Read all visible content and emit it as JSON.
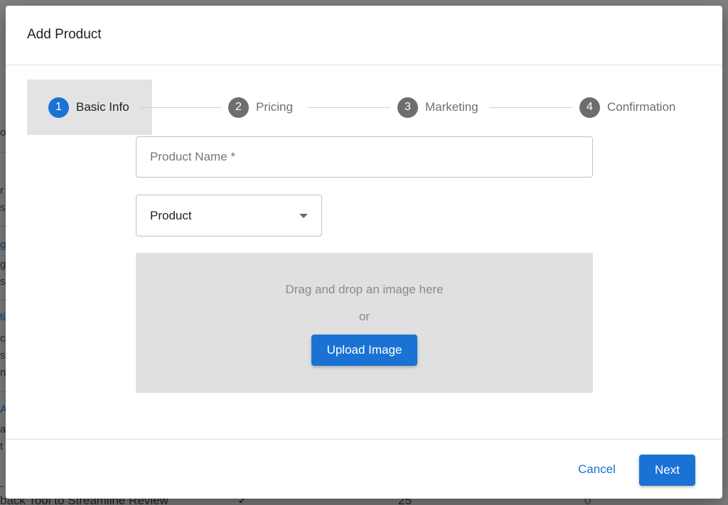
{
  "background": {
    "fragments": [
      {
        "text": "o",
        "link": false
      },
      {
        "text": "r",
        "link": false
      },
      {
        "text": "s",
        "link": false
      },
      {
        "text": "g",
        "link": true
      },
      {
        "text": "g",
        "link": false
      },
      {
        "text": "s",
        "link": false
      },
      {
        "text": "ti",
        "link": true
      },
      {
        "text": "c",
        "link": false
      },
      {
        "text": "s",
        "link": false
      },
      {
        "text": "n",
        "link": false
      },
      {
        "text": "A",
        "link": true
      },
      {
        "text": "a",
        "link": false
      },
      {
        "text": "t",
        "link": false
      },
      {
        "text": "-",
        "link": false
      }
    ],
    "bottom_row": {
      "title": "back Tool to Streamline Review",
      "check": "✓",
      "count": "25",
      "zero": "0"
    }
  },
  "modal": {
    "title": "Add Product",
    "steps": [
      {
        "number": "1",
        "label": "Basic Info",
        "active": true
      },
      {
        "number": "2",
        "label": "Pricing",
        "active": false
      },
      {
        "number": "3",
        "label": "Marketing",
        "active": false
      },
      {
        "number": "4",
        "label": "Confirmation",
        "active": false
      }
    ],
    "product_name": {
      "placeholder": "Product Name *",
      "value": ""
    },
    "type_select": {
      "value": "Product"
    },
    "dropzone": {
      "prompt": "Drag and drop an image here",
      "or": "or",
      "upload_label": "Upload Image"
    },
    "footer": {
      "cancel_label": "Cancel",
      "next_label": "Next"
    },
    "colors": {
      "accent": "#1a73d4",
      "active_step_bg": "#e3e3e3",
      "dropzone_bg": "#e0e0e0"
    }
  }
}
